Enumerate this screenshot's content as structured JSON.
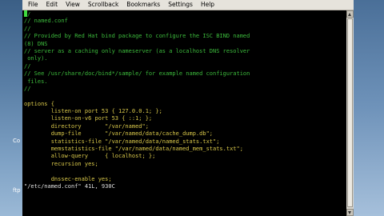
{
  "menubar": {
    "items": [
      "File",
      "Edit",
      "View",
      "Scrollback",
      "Bookmarks",
      "Settings",
      "Help"
    ]
  },
  "desktop": {
    "left_labels": [
      "Co",
      "ftp"
    ]
  },
  "editor": {
    "lines": [
      {
        "t": "//",
        "k": "comment"
      },
      {
        "t": "// named.conf",
        "k": "comment"
      },
      {
        "t": "//",
        "k": "comment"
      },
      {
        "t": "// Provided by Red Hat bind package to configure the ISC BIND named",
        "k": "comment"
      },
      {
        "t": "(8) DNS",
        "k": "comment"
      },
      {
        "t": "// server as a caching only nameserver (as a localhost DNS resolver",
        "k": "comment"
      },
      {
        "t": " only).",
        "k": "comment"
      },
      {
        "t": "//",
        "k": "comment"
      },
      {
        "t": "// See /usr/share/doc/bind*/sample/ for example named configuration",
        "k": "comment"
      },
      {
        "t": " files.",
        "k": "comment"
      },
      {
        "t": "//",
        "k": "comment"
      },
      {
        "t": "",
        "k": "plain"
      },
      {
        "t": "options {",
        "k": "keyword"
      },
      {
        "t": "        listen-on port 53 { 127.0.0.1; };",
        "k": "keyword"
      },
      {
        "t": "        listen-on-v6 port 53 { ::1; };",
        "k": "keyword"
      },
      {
        "t": "        directory       \"/var/named\";",
        "k": "keyword"
      },
      {
        "t": "        dump-file       \"/var/named/data/cache_dump.db\";",
        "k": "keyword"
      },
      {
        "t": "        statistics-file \"/var/named/data/named_stats.txt\";",
        "k": "keyword"
      },
      {
        "t": "        memstatistics-file \"/var/named/data/named_mem_stats.txt\";",
        "k": "keyword"
      },
      {
        "t": "        allow-query     { localhost; };",
        "k": "keyword"
      },
      {
        "t": "        recursion yes;",
        "k": "keyword"
      },
      {
        "t": "",
        "k": "plain"
      },
      {
        "t": "        dnssec-enable yes;",
        "k": "keyword"
      }
    ],
    "status_line": "\"/etc/named.conf\" 41L, 930C"
  }
}
